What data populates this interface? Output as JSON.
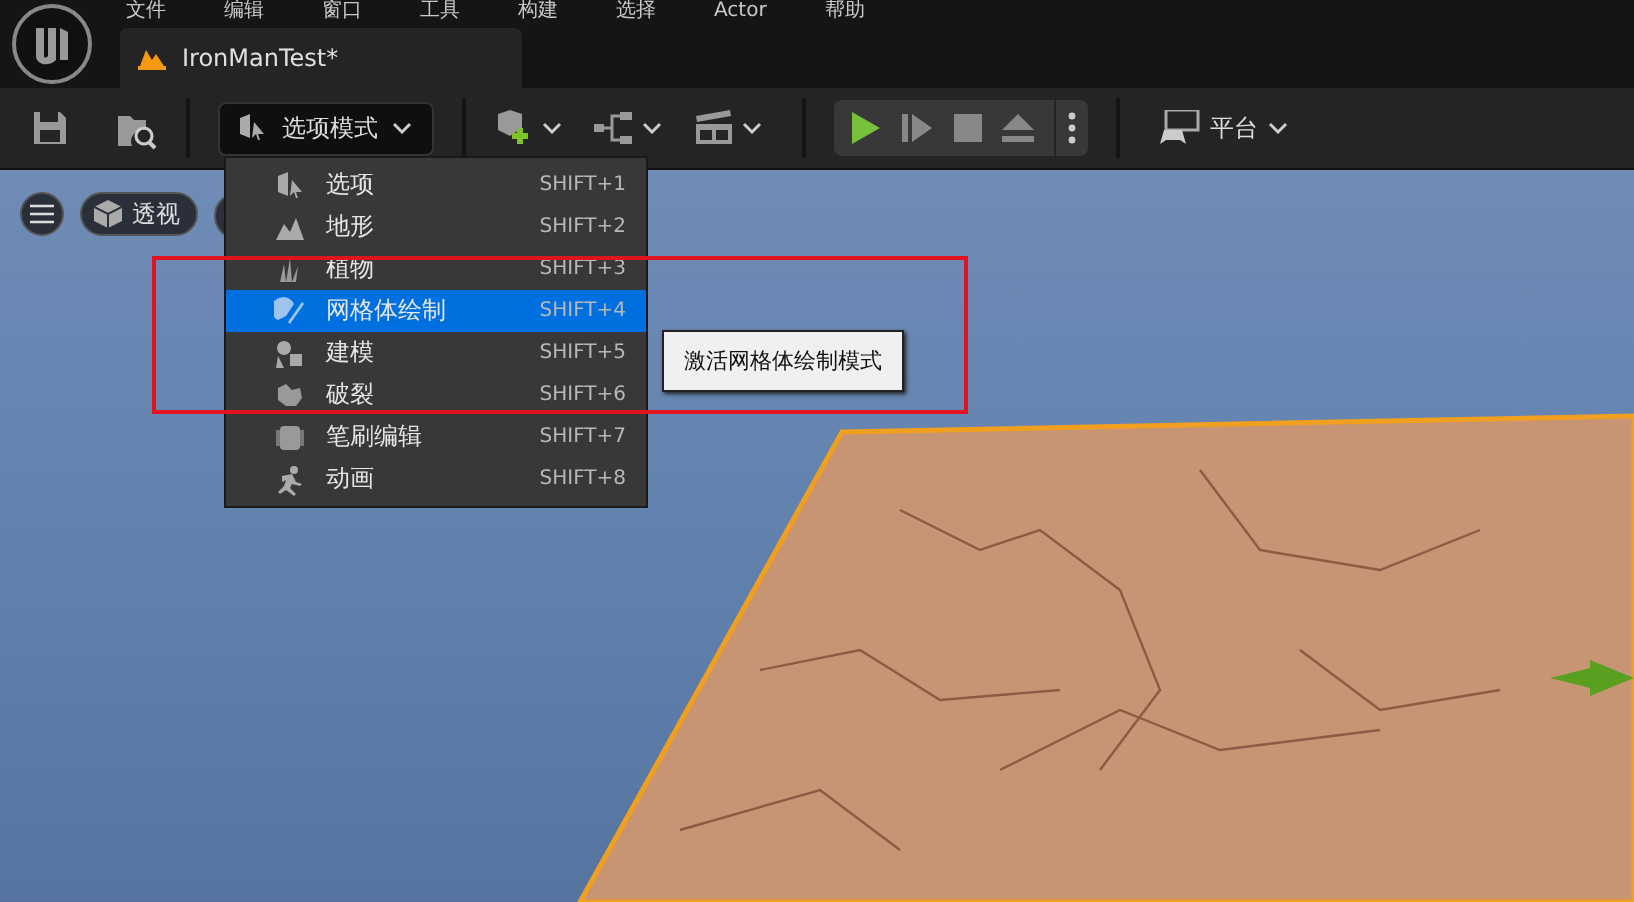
{
  "menu_bar": [
    "文件",
    "编辑",
    "窗口",
    "工具",
    "构建",
    "选择",
    "Actor",
    "帮助"
  ],
  "document_tab": {
    "title": "IronManTest*"
  },
  "toolbar": {
    "mode_button": "选项模式",
    "platform_button": "平台"
  },
  "viewport": {
    "view_button": "透视"
  },
  "mode_menu": {
    "items": [
      {
        "label": "选项",
        "shortcut": "SHIFT+1",
        "selected": false
      },
      {
        "label": "地形",
        "shortcut": "SHIFT+2",
        "selected": false
      },
      {
        "label": "植物",
        "shortcut": "SHIFT+3",
        "selected": false
      },
      {
        "label": "网格体绘制",
        "shortcut": "SHIFT+4",
        "selected": true
      },
      {
        "label": "建模",
        "shortcut": "SHIFT+5",
        "selected": false
      },
      {
        "label": "破裂",
        "shortcut": "SHIFT+6",
        "selected": false
      },
      {
        "label": "笔刷编辑",
        "shortcut": "SHIFT+7",
        "selected": false
      },
      {
        "label": "动画",
        "shortcut": "SHIFT+8",
        "selected": false
      }
    ]
  },
  "tooltip": "激活网格体绘制模式"
}
